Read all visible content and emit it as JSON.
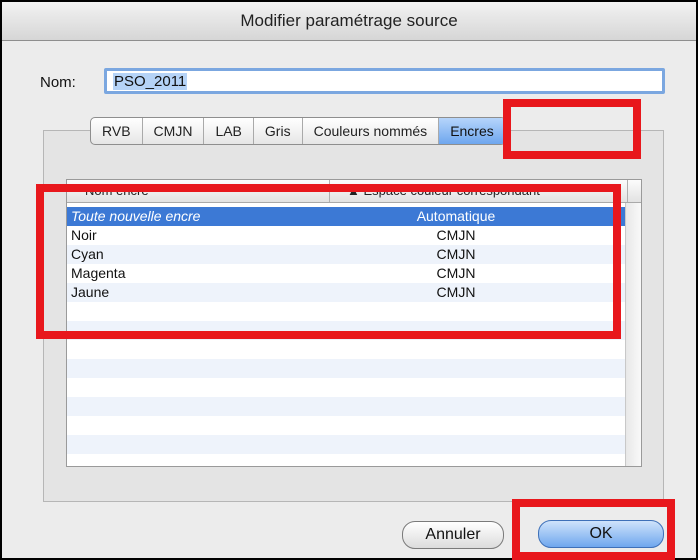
{
  "window": {
    "title": "Modifier paramétrage source"
  },
  "name_field": {
    "label": "Nom:",
    "value": "PSO_2011"
  },
  "tabs": [
    {
      "label": "RVB",
      "active": false
    },
    {
      "label": "CMJN",
      "active": false
    },
    {
      "label": "LAB",
      "active": false
    },
    {
      "label": "Gris",
      "active": false
    },
    {
      "label": "Couleurs nommés",
      "active": false
    },
    {
      "label": "Encres",
      "active": true
    }
  ],
  "table": {
    "columns": [
      "Nom encre",
      "▲ Espace couleur correspondant"
    ],
    "rows": [
      {
        "name": "Toute nouvelle encre",
        "space": "Automatique",
        "selected": true
      },
      {
        "name": "Noir",
        "space": "CMJN"
      },
      {
        "name": "Cyan",
        "space": "CMJN"
      },
      {
        "name": "Magenta",
        "space": "CMJN"
      },
      {
        "name": "Jaune",
        "space": "CMJN"
      }
    ]
  },
  "buttons": {
    "cancel": "Annuler",
    "ok": "OK"
  },
  "colors": {
    "highlight": "#e8171c",
    "selection": "#3c79d5",
    "accent": "#6fa7ee"
  }
}
